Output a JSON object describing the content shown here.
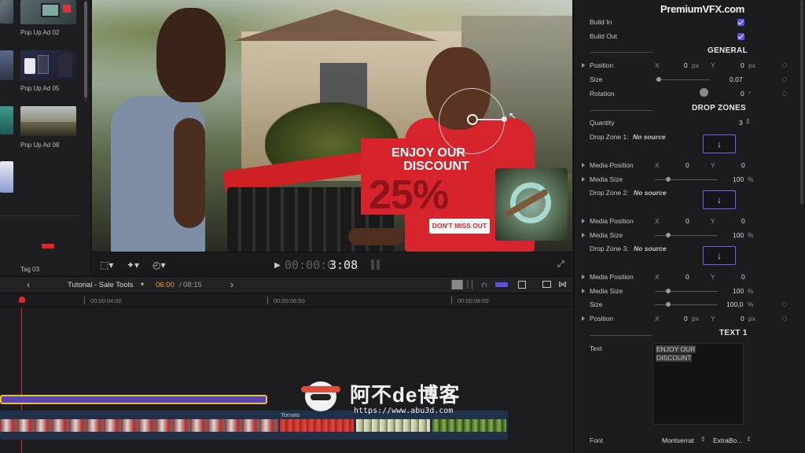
{
  "browser": {
    "items": [
      {
        "label": "Pop Up Ad 02"
      },
      {
        "label": "Pop Up Ad 05"
      },
      {
        "label": "Pop Up Ad 08"
      }
    ],
    "tag_label": "Tag 03"
  },
  "viewer": {
    "ad_headline_line1": "ENJOY OUR",
    "ad_headline_line2": "DISCOUNT",
    "ad_percent": "25%",
    "ad_cta": "DON'T MISS OUT",
    "timecode_dim": "00:00:0",
    "timecode_bright": "3:08"
  },
  "timeline": {
    "project_name": "Tutorial - Sale Tools",
    "current_time": "06:00",
    "separator": "/",
    "total_time": "08:15",
    "ruler_marks": [
      "00:00:04:00",
      "00:00:06:00",
      "00:00:08:00"
    ],
    "clip_label": "Tomato"
  },
  "watermark": {
    "title": "阿不de博客",
    "url": "https://www.abu3d.com"
  },
  "inspector": {
    "brand": "PremiumVFX.com",
    "build_in_label": "Build In",
    "build_out_label": "Build Out",
    "general": {
      "title": "GENERAL",
      "position_label": "Position",
      "x_axis": "X",
      "x_val": "0",
      "x_unit": "px",
      "y_axis": "Y",
      "y_val": "0",
      "y_unit": "px",
      "size_label": "Size",
      "size_val": "0,07",
      "rotation_label": "Rotation",
      "rotation_val": "0",
      "rotation_unit": "°"
    },
    "drop_zones": {
      "title": "DROP ZONES",
      "quantity_label": "Quantity",
      "quantity_val": "3",
      "zones": [
        {
          "label": "Drop Zone 1:",
          "source": "No source",
          "media_position_label": "Media Position",
          "x_axis": "X",
          "x_val": "0",
          "y_axis": "Y",
          "y_val": "0",
          "media_size_label": "Media Size",
          "media_size_val": "100",
          "media_size_unit": "%"
        },
        {
          "label": "Drop Zone 2:",
          "source": "No source",
          "media_position_label": "Media Position",
          "x_axis": "X",
          "x_val": "0",
          "y_axis": "Y",
          "y_val": "0",
          "media_size_label": "Media Size",
          "media_size_val": "100",
          "media_size_unit": "%"
        },
        {
          "label": "Drop Zone 3:",
          "source": "No source",
          "media_position_label": "Media Position",
          "x_axis": "X",
          "x_val": "0",
          "y_axis": "Y",
          "y_val": "0",
          "media_size_label": "Media Size",
          "media_size_val": "100",
          "media_size_unit": "%"
        }
      ],
      "size_label": "Size",
      "size_val": "100,0",
      "size_unit": "%",
      "position_label": "Position",
      "pos_x_axis": "X",
      "pos_x_val": "0",
      "pos_x_unit": "px",
      "pos_y_axis": "Y",
      "pos_y_val": "0",
      "pos_y_unit": "px"
    },
    "text1": {
      "title": "TEXT 1",
      "text_label": "Text",
      "text_line1": "ENJOY OUR",
      "text_line2": "DISCOUNT",
      "font_label": "Font",
      "font_family": "Montserrat",
      "font_weight": "ExtraBo..."
    },
    "accent_color": "#5a55e0"
  }
}
